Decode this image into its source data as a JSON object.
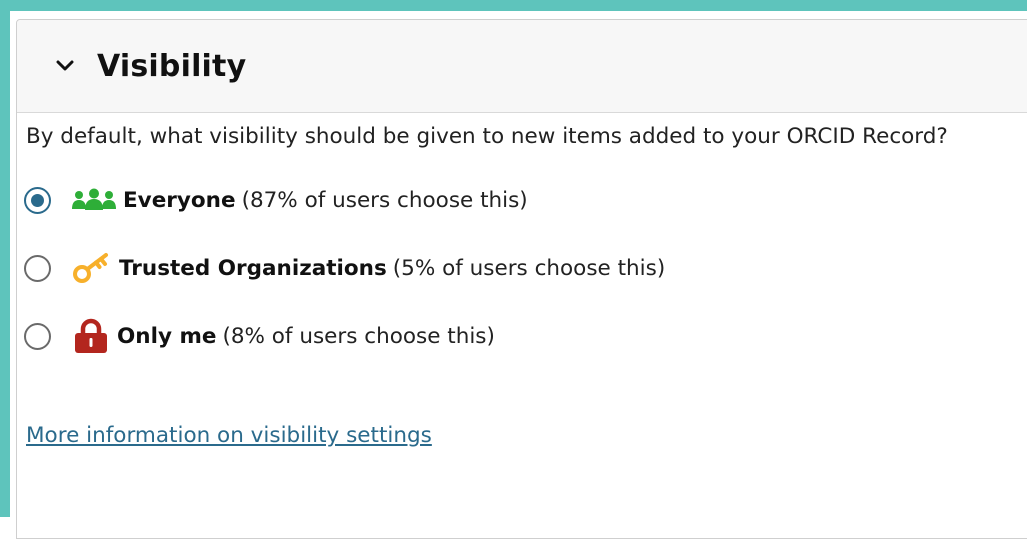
{
  "colors": {
    "accent": "#5ec4bc",
    "link": "#2a6a8c",
    "radio_selected": "#2a6a8c",
    "everyone_icon": "#2eae38",
    "trusted_icon": "#f7b02b",
    "onlyme_icon": "#b3261e"
  },
  "panel": {
    "title": "Visibility",
    "toggle_icon": "chevron-down-icon"
  },
  "question": "By default, what visibility should be given to new items added to your ORCID Record?",
  "options": [
    {
      "label": "Everyone",
      "note": "(87% of users choose this)",
      "icon": "people-group-icon",
      "selected": true
    },
    {
      "label": "Trusted Organizations",
      "note": "(5% of users choose this)",
      "icon": "key-icon",
      "selected": false
    },
    {
      "label": "Only me",
      "note": "(8% of users choose this)",
      "icon": "lock-icon",
      "selected": false
    }
  ],
  "more_link": "More information on visibility settings"
}
